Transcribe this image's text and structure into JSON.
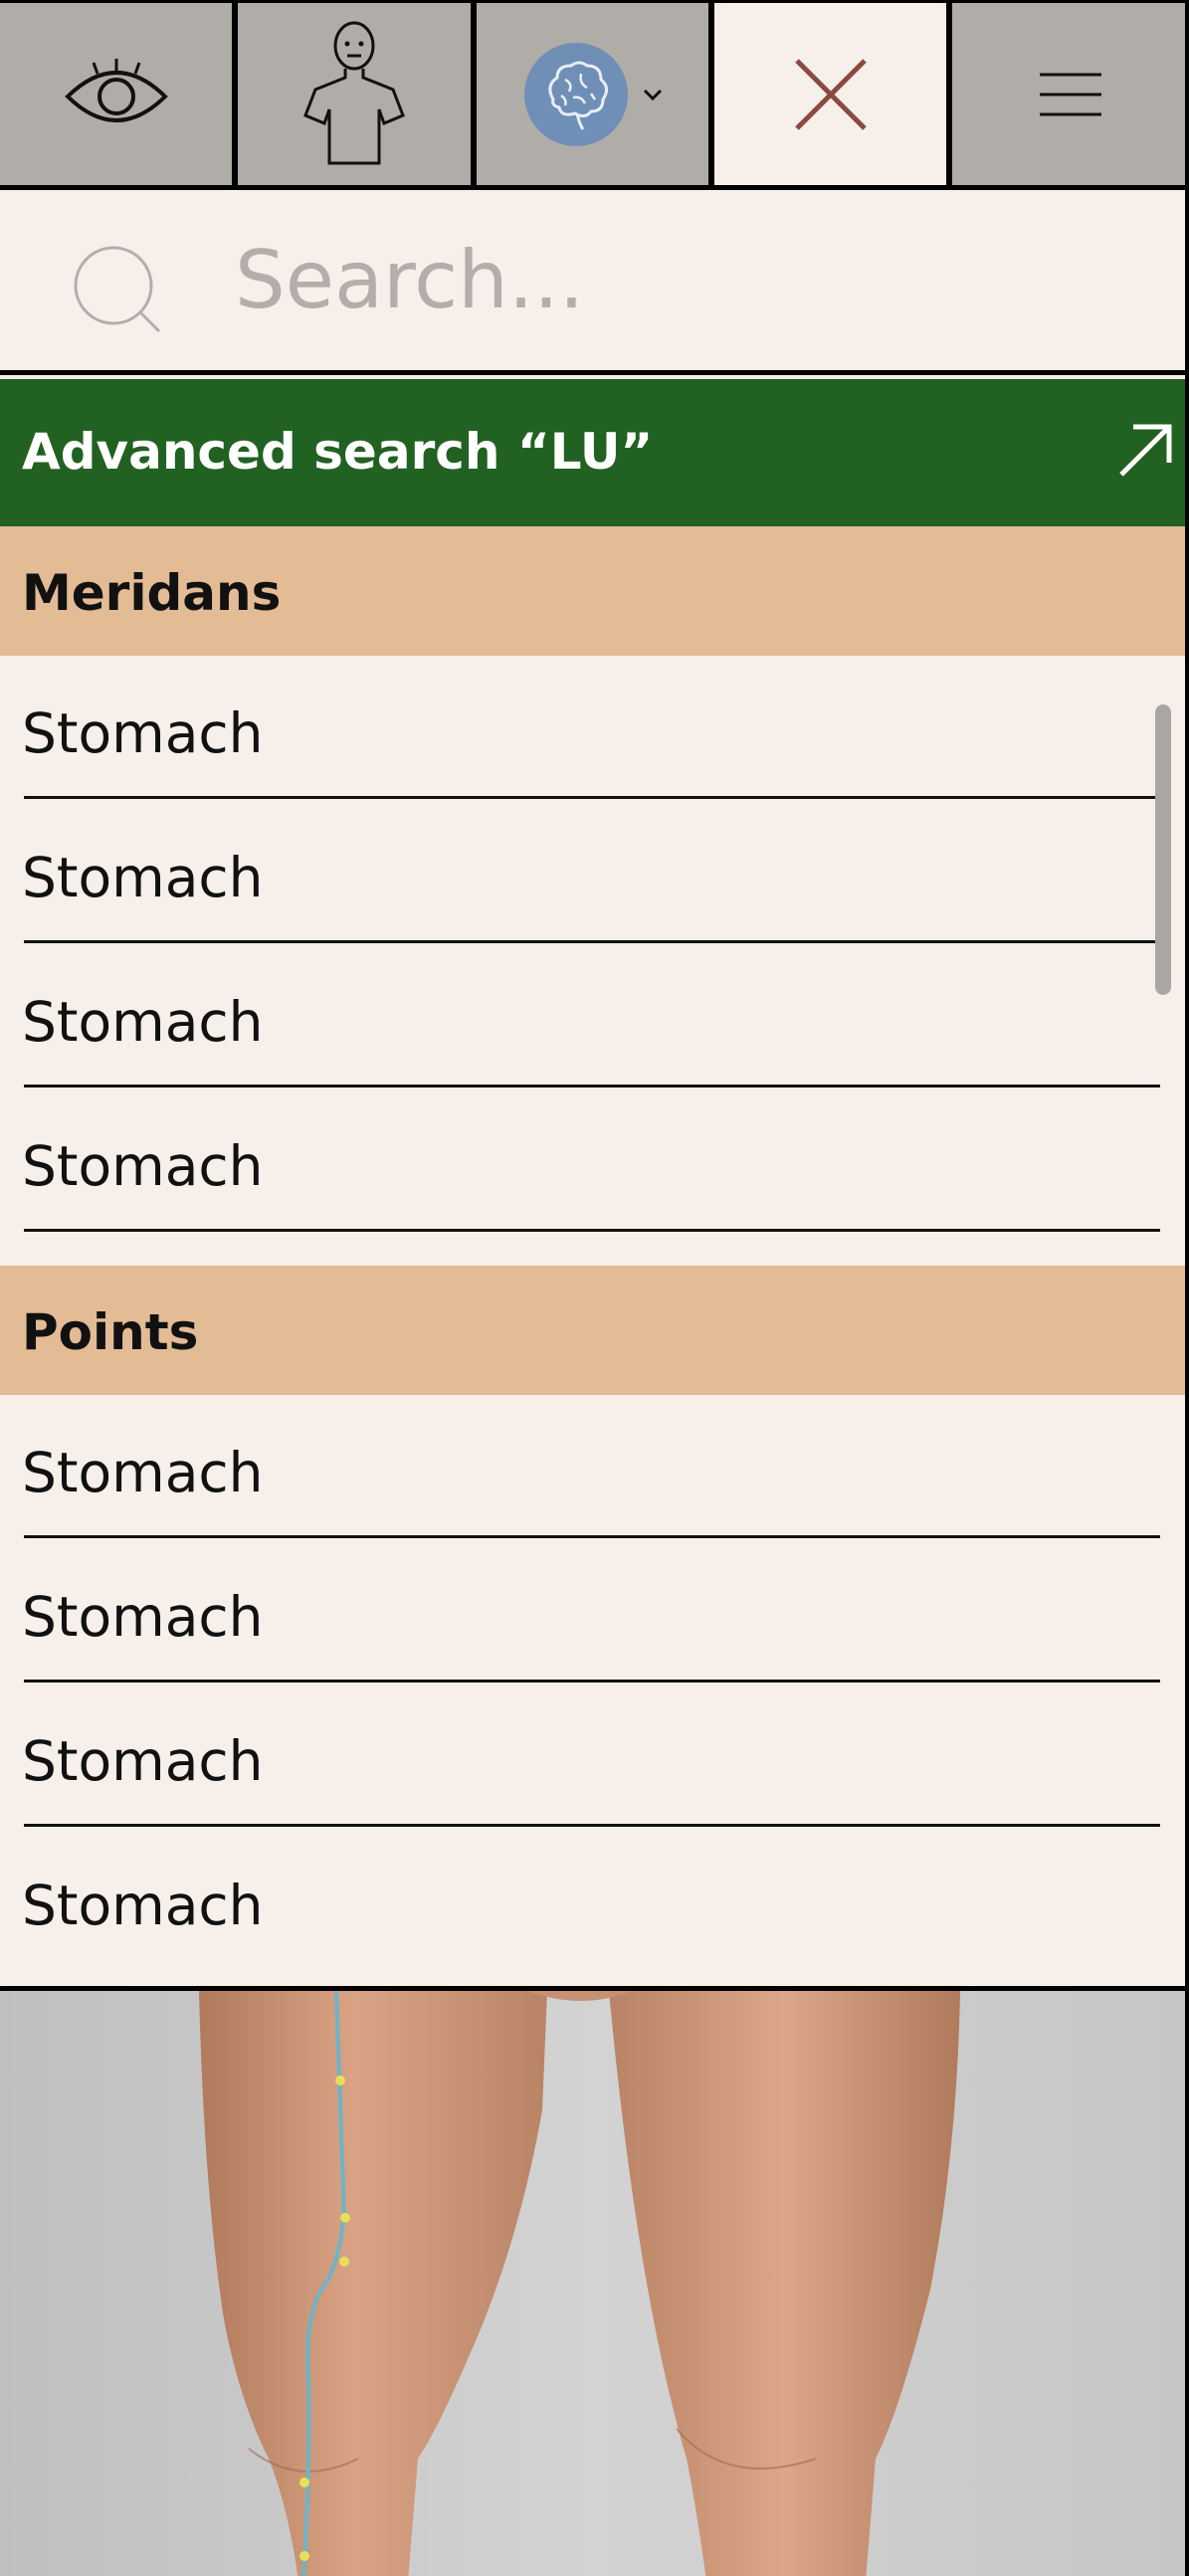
{
  "toolbar": {
    "buttons": [
      {
        "icon": "eye-icon"
      },
      {
        "icon": "body-icon"
      },
      {
        "icon": "brain-icon",
        "dropdown": "chevron-down-icon"
      },
      {
        "icon": "close-icon",
        "active": true
      },
      {
        "icon": "menu-icon"
      }
    ]
  },
  "search": {
    "placeholder": "Search...",
    "value": ""
  },
  "advanced": {
    "label": "Advanced search “LU”",
    "icon": "external-arrow-icon"
  },
  "sections": [
    {
      "title": "Meridans",
      "items": [
        "Stomach",
        "Stomach",
        "Stomach",
        "Stomach"
      ]
    },
    {
      "title": "Points",
      "items": [
        "Stomach",
        "Stomach",
        "Stomach",
        "Stomach"
      ]
    }
  ],
  "colors": {
    "toolbar_bg": "#b0aca8",
    "active_bg": "#f7efe9",
    "advanced_bg": "#216121",
    "section_bg": "#e3bb95",
    "list_bg": "#f7efe9",
    "close_color": "#8a4a40",
    "brain_badge": "#6f8fb6"
  }
}
